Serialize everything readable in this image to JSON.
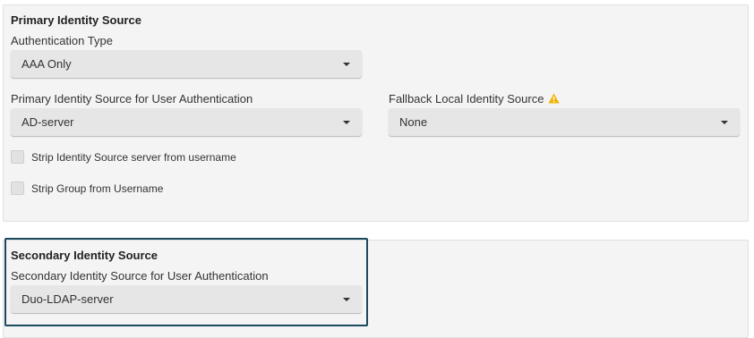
{
  "primary": {
    "title": "Primary Identity Source",
    "auth_type": {
      "label": "Authentication Type",
      "value": "AAA Only"
    },
    "user_auth_source": {
      "label": "Primary Identity Source for User Authentication",
      "value": "AD-server"
    },
    "fallback_source": {
      "label": "Fallback Local Identity Source",
      "value": "None",
      "warning_icon": "warning-triangle-icon",
      "warning_color": "#f0b400"
    },
    "checkboxes": [
      {
        "label": "Strip Identity Source server from username",
        "checked": false
      },
      {
        "label": "Strip Group from Username",
        "checked": false
      }
    ]
  },
  "secondary": {
    "title": "Secondary Identity Source",
    "user_auth_source": {
      "label": "Secondary Identity Source for User Authentication",
      "value": "Duo-LDAP-server"
    },
    "highlight_color": "#1b4a5e"
  }
}
